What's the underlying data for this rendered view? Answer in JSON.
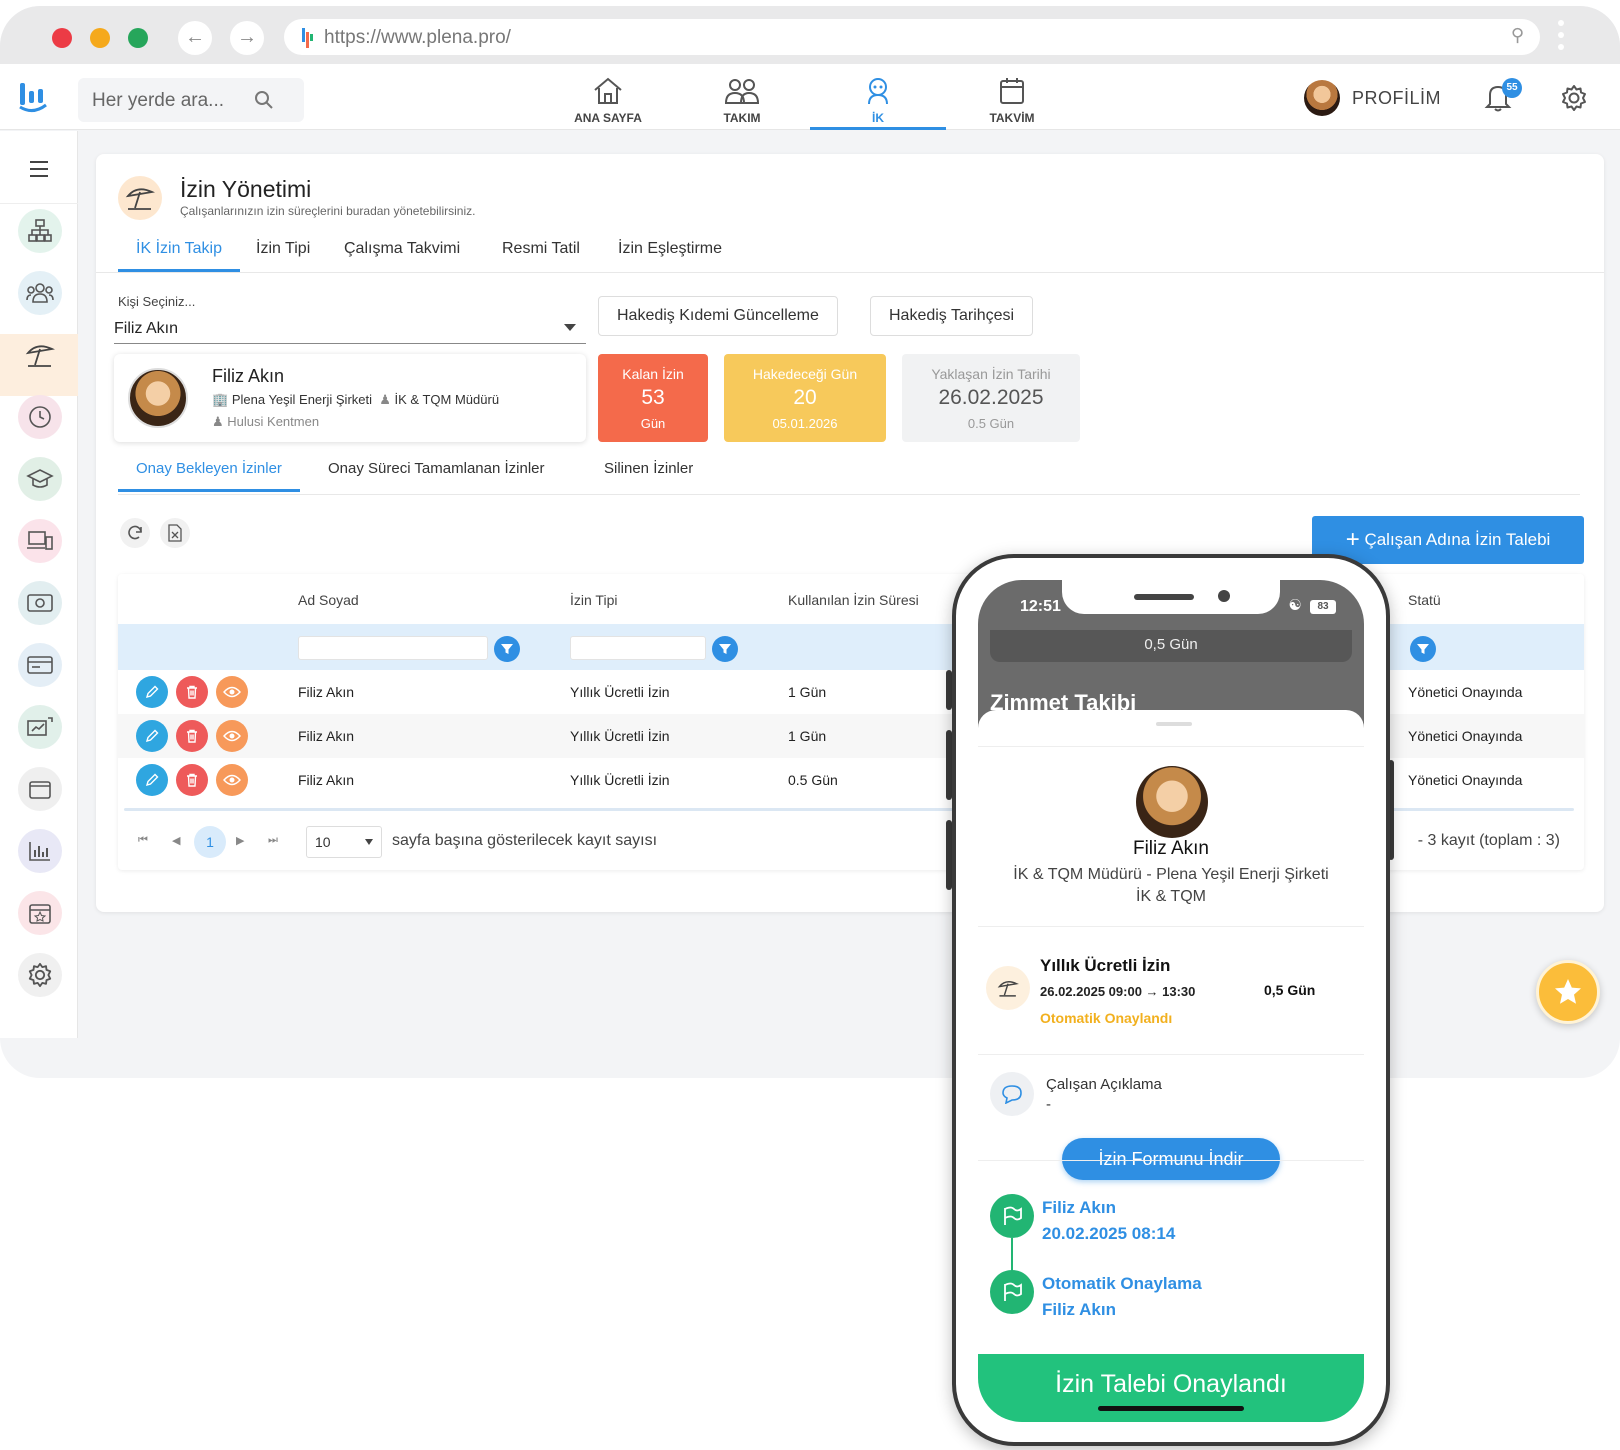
{
  "browser": {
    "url": "https://www.plena.pro/",
    "colors": {
      "close": "#ec3b45",
      "minimize": "#f5a91c",
      "maximize": "#26a65b"
    }
  },
  "appbar": {
    "search_placeholder": "Her yerde ara...",
    "nav": [
      {
        "label": "ANA SAYFA",
        "icon": "home-icon"
      },
      {
        "label": "TAKIM",
        "icon": "team-icon"
      },
      {
        "label": "İK",
        "icon": "hr-icon",
        "active": true
      },
      {
        "label": "TAKVİM",
        "icon": "calendar-icon"
      }
    ],
    "profile_label": "PROFİLİM",
    "notification_count": "55"
  },
  "sidebar": {
    "items": [
      {
        "icon": "org-chart-icon",
        "color": "#e3f3ec"
      },
      {
        "icon": "people-icon",
        "color": "#e4f0f6"
      },
      {
        "icon": "umbrella-icon",
        "color": "#fdeede",
        "active": true
      },
      {
        "icon": "clock-icon",
        "color": "#f7e3ea"
      },
      {
        "icon": "graduation-icon",
        "color": "#e1efe6"
      },
      {
        "icon": "devices-icon",
        "color": "#fbe3ea"
      },
      {
        "icon": "money-icon",
        "color": "#e2eef0"
      },
      {
        "icon": "card-icon",
        "color": "#e4eef6"
      },
      {
        "icon": "expense-icon",
        "color": "#e1f0ea"
      },
      {
        "icon": "wallet-icon",
        "color": "#efefef"
      },
      {
        "icon": "report-icon",
        "color": "#e8e8f6"
      },
      {
        "icon": "event-icon",
        "color": "#fbe5e8"
      },
      {
        "icon": "settings-icon",
        "color": "#f0f0f0"
      }
    ]
  },
  "page": {
    "title": "İzin Yönetimi",
    "subtitle": "Çalışanlarınızın izin süreçlerini buradan yönetebilirsiniz.",
    "tabs": [
      "İK İzin Takip",
      "İzin Tipi",
      "Çalışma Takvimi",
      "Resmi Tatil",
      "İzin Eşleştirme"
    ],
    "person_select_label": "Kişi Seçiniz...",
    "person_select_value": "Filiz Akın",
    "person": {
      "name": "Filiz Akın",
      "company": "Plena Yeşil Enerji Şirketi",
      "role": "İK & TQM Müdürü",
      "manager": "Hulusi Kentmen"
    },
    "buttons": {
      "seniority": "Hakediş Kıdemi Güncelleme",
      "history": "Hakediş Tarihçesi",
      "add_request": "Çalışan Adına İzin Talebi"
    },
    "stats": {
      "remaining": {
        "label": "Kalan İzin",
        "value": "53",
        "unit": "Gün",
        "color": "#f46a4b"
      },
      "entitled": {
        "label": "Hakedeceği Gün",
        "value": "20",
        "date": "05.01.2026",
        "color": "#f7c95b"
      },
      "upcoming": {
        "label": "Yaklaşan İzin Tarihi",
        "value": "26.02.2025",
        "sub": "0.5 Gün"
      }
    },
    "subtabs": [
      "Onay Bekleyen İzinler",
      "Onay Süreci Tamamlanan İzinler",
      "Silinen İzinler"
    ],
    "table": {
      "headers": {
        "name": "Ad Soyad",
        "type": "İzin Tipi",
        "used": "Kullanılan İzin Süresi",
        "status": "Statü"
      },
      "rows": [
        {
          "name": "Filiz Akın",
          "type": "Yıllık Ücretli İzin",
          "used": "1 Gün",
          "status": "Yönetici Onayında"
        },
        {
          "name": "Filiz Akın",
          "type": "Yıllık Ücretli İzin",
          "used": "1 Gün",
          "status": "Yönetici Onayında"
        },
        {
          "name": "Filiz Akın",
          "type": "Yıllık Ücretli İzin",
          "used": "0.5 Gün",
          "status": "Yönetici Onayında"
        }
      ]
    },
    "pager": {
      "current_page": "1",
      "page_size": "10",
      "page_size_label": "sayfa başına gösterilecek kayıt sayısı",
      "total_label": "- 3 kayıt (toplam : 3)"
    }
  },
  "mobile": {
    "time": "12:51",
    "battery": "83",
    "chip_text": "0,5 Gün",
    "behind_title": "Zimmet Takibi",
    "name": "Filiz Akın",
    "role": "İK & TQM Müdürü - Plena Yeşil Enerji Şirketi  İK & TQM",
    "leave_type": "Yıllık Ücretli İzin",
    "leave_range": "26.02.2025 09:00 → 13:30",
    "leave_duration": "0,5 Gün",
    "leave_status": "Otomatik Onaylandı",
    "explanation_label": "Çalışan Açıklama",
    "explanation_value": "-",
    "download_button": "İzin Formunu İndir",
    "timeline": [
      {
        "title": "Filiz Akın",
        "date": "20.02.2025 08:14"
      },
      {
        "title": "Otomatik Onaylama",
        "date": "Filiz Akın"
      }
    ],
    "banner": "İzin Talebi Onaylandı"
  }
}
